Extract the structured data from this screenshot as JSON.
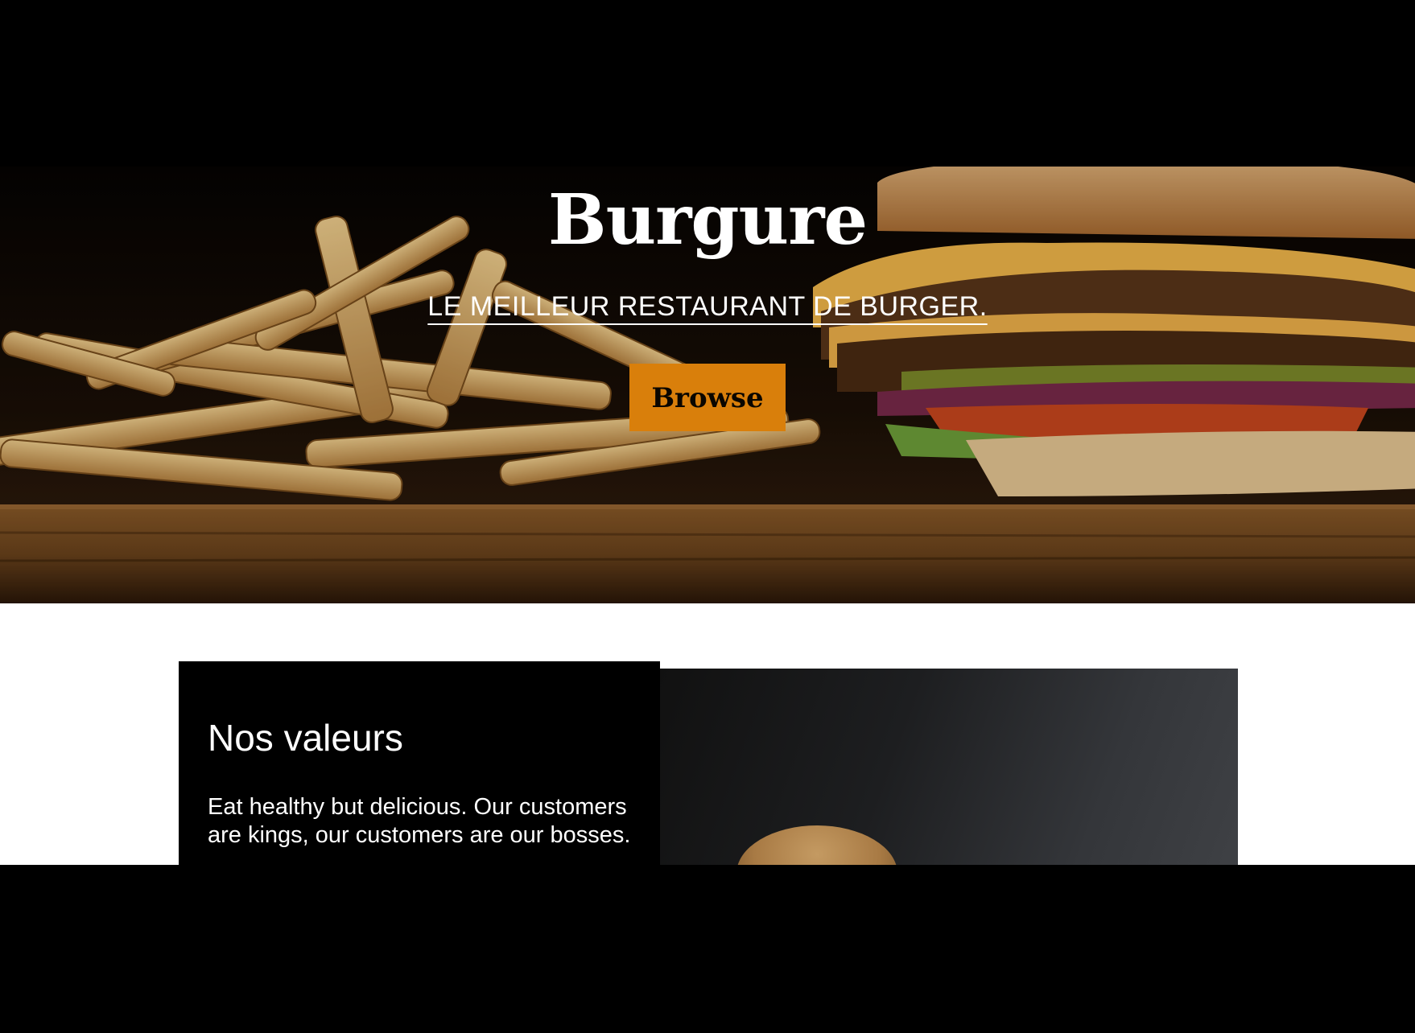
{
  "hero": {
    "title": "Burgure",
    "subtitle": "LE MEILLEUR RESTAURANT DE BURGER.",
    "browse_label": "Browse",
    "image": "fries-and-burger-photo"
  },
  "values": {
    "heading": "Nos valeurs",
    "text": "Eat healthy but delicious. Our customers are kings, our customers are our bosses.",
    "image": "burger-on-dark-background-photo"
  },
  "colors": {
    "accent": "#d97f0b",
    "background": "#000000",
    "text_light": "#ffffff"
  }
}
